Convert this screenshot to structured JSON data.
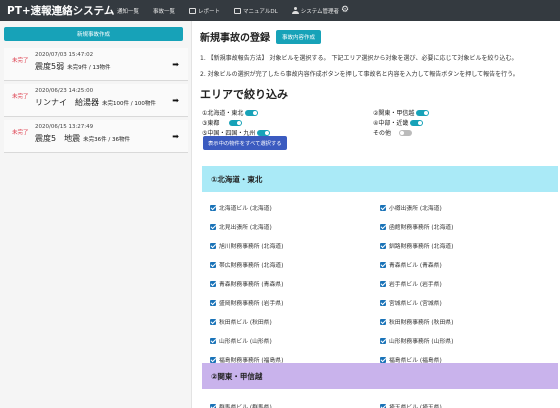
{
  "navbar": {
    "brand": "PT+速報連絡システム",
    "items": [
      {
        "label": "通知一覧"
      },
      {
        "label": "事故一覧"
      },
      {
        "label": "レポート",
        "icon": "document-icon"
      },
      {
        "label": "マニュアルDL",
        "icon": "book-icon"
      },
      {
        "label": "システム管理者",
        "icon": "user-icon"
      }
    ],
    "gear_icon": "⚙"
  },
  "sidebar": {
    "new_button": "新規事故作成",
    "reports": [
      {
        "status": "未完了",
        "date": "2020/07/03 15:47:02",
        "title": "震度5弱",
        "count": "未完9件 / 13物件",
        "arrow": "➡"
      },
      {
        "status": "未完了",
        "date": "2020/06/23 14:25:00",
        "title": "リンナイ　給湯器",
        "count": "未完100件 / 100物件",
        "arrow": "➡"
      },
      {
        "status": "未完了",
        "date": "2020/06/15 13:27:49",
        "title": "震度5　地震",
        "count": "未完36件 / 36物件",
        "arrow": "➡"
      }
    ]
  },
  "main": {
    "title": "新規事故の登録",
    "create_button": "事故内容作成",
    "instruction1": "1. 【新規事故報告方法】 対象ビルを選択する。 下記エリア選択から対象を選び、必要に応じて対象ビルを絞り込む。",
    "instruction2": "2. 対象ビルの選択が完了したら事故内容作成ボタンを押して事故名と内容を入力して報告ボタンを押して報告を行う。",
    "area_title": "エリアで絞り込み",
    "filters": [
      {
        "label": "①北海道・東北",
        "on": true
      },
      {
        "label": "②関東・甲信越",
        "on": true
      },
      {
        "label": "③東都",
        "on": true
      },
      {
        "label": "④中部・近畿",
        "on": true
      },
      {
        "label": "⑤中国・四国・九州",
        "on": true
      },
      {
        "label": "その他",
        "on": false
      }
    ],
    "select_all": "表示中の物件をすべて選択する",
    "section1": "①北海道・東北",
    "section1_items": [
      [
        "北海道ビル (北海道)",
        "小樽出張所 (北海道)"
      ],
      [
        "北見出張所 (北海道)",
        "函館財務事務所 (北海道)"
      ],
      [
        "旭川財務事務所 (北海道)",
        "釧路財務事務所 (北海道)"
      ],
      [
        "帯広財務事務所 (北海道)",
        "青森県ビル (青森県)"
      ],
      [
        "青森財務事務所 (青森県)",
        "岩手県ビル (岩手県)"
      ],
      [
        "盛岡財務事務所 (岩手県)",
        "宮城県ビル (宮城県)"
      ],
      [
        "秋田県ビル (秋田県)",
        "秋田財務事務所 (秋田県)"
      ],
      [
        "山形県ビル (山形県)",
        "山形財務事務所 (山形県)"
      ],
      [
        "福島財務事務所 (福島県)",
        "福島県ビル (福島県)"
      ]
    ],
    "section2": "②関東・甲信越",
    "section2_items": [
      [
        "群馬県ビル (群馬県)",
        "埼玉県ビル (埼玉県)"
      ]
    ]
  }
}
